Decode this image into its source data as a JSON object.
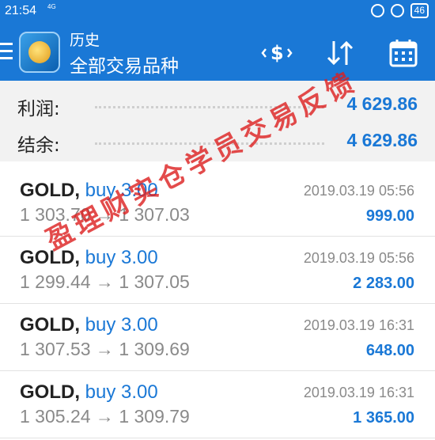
{
  "status_bar": {
    "time": "21:54",
    "network": "4G",
    "battery": "46"
  },
  "app_bar": {
    "title": "历史",
    "subtitle": "全部交易品种"
  },
  "summary": {
    "profit_label": "利润:",
    "profit_value": "4 629.86",
    "balance_label": "结余:",
    "balance_value": "4 629.86"
  },
  "trades": [
    {
      "symbol": "GOLD,",
      "side": "buy 3.00",
      "open": "1 303.70",
      "close": "1 307.03",
      "time": "2019.03.19 05:56",
      "profit": "999.00"
    },
    {
      "symbol": "GOLD,",
      "side": "buy 3.00",
      "open": "1 299.44",
      "close": "1 307.05",
      "time": "2019.03.19 05:56",
      "profit": "2 283.00"
    },
    {
      "symbol": "GOLD,",
      "side": "buy 3.00",
      "open": "1 307.53",
      "close": "1 309.69",
      "time": "2019.03.19 16:31",
      "profit": "648.00"
    },
    {
      "symbol": "GOLD,",
      "side": "buy 3.00",
      "open": "1 305.24",
      "close": "1 309.79",
      "time": "2019.03.19 16:31",
      "profit": "1 365.00"
    }
  ],
  "arrow": "→",
  "watermark": "盈理财实仓学员交易反馈",
  "colors": {
    "accent": "#1a78d6",
    "watermark": "#dc1e1e"
  }
}
